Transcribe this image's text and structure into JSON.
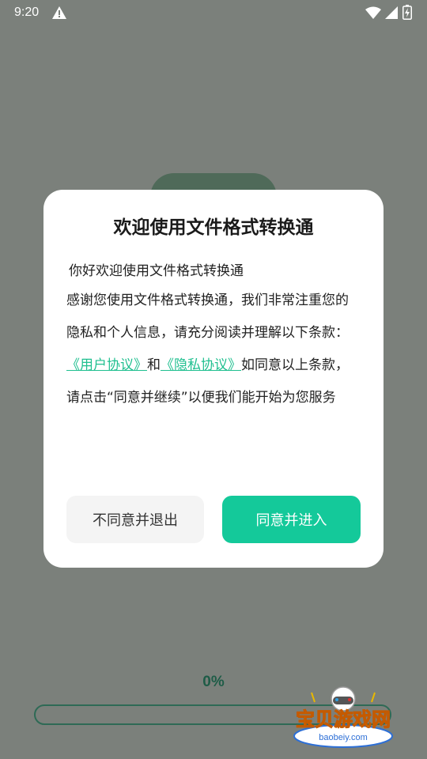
{
  "status_bar": {
    "time": "9:20",
    "icons": [
      "warning-icon",
      "wifi-icon",
      "signal-icon",
      "battery-icon"
    ]
  },
  "dialog": {
    "title": "欢迎使用文件格式转换通",
    "greeting": "你好欢迎使用文件格式转换通",
    "paragraph": "感谢您使用文件格式转换通，我们非常注重您的隐私和个人信息，请充分阅读并理解以下条款：",
    "link_user_agreement": "《用户协议》",
    "and_text": "和",
    "link_privacy_policy": "《隐私协议》",
    "consent_text": "如同意以上条款，请点击“同意并继续”以便我们能开始为您服务",
    "disagree_button": "不同意并退出",
    "agree_button": "同意并进入"
  },
  "progress": {
    "label": "0%",
    "value": 0
  },
  "watermark": {
    "text": "宝贝游戏网",
    "url": "baobeiy.com"
  },
  "colors": {
    "accent": "#14c99a",
    "link": "#1fbf8f",
    "overlay": "#7b807b",
    "progress_text": "#1e5c47"
  }
}
